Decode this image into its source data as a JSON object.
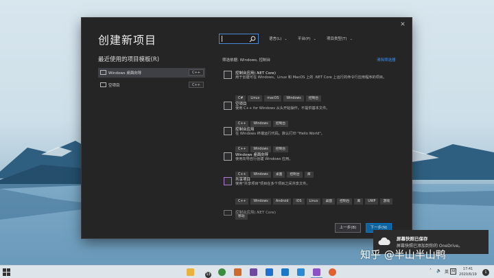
{
  "dialog": {
    "title": "创建新项目",
    "recent_heading": "最近使用的项目模板(R)",
    "close_glyph": "✕",
    "search": {
      "placeholder": ""
    },
    "filters": {
      "language": "语言(L)",
      "platform": "平台(P)",
      "project_type": "项目类型(T)"
    },
    "recent": [
      {
        "label": "Windows 桌面向导",
        "tag": "C++"
      },
      {
        "label": "空项目",
        "tag": "C++"
      }
    ],
    "filter_status": "筛选依据: Windows, 控制台",
    "clear_filter": "清除筛选器",
    "templates": [
      {
        "name": "控制台应用(.NET Core)",
        "desc": "用于创建可在 Windows、Linux 和 MacOS 上的 .NET Core 上运行的命令行应用程序的项目。",
        "tags": [
          "C#",
          "Linux",
          "macOS",
          "Windows",
          "控制台"
        ]
      },
      {
        "name": "空项目",
        "desc": "使用 C++ for Windows 从头开始操作。不提供基本文件。",
        "tags": [
          "C++",
          "Windows",
          "控制台"
        ]
      },
      {
        "name": "控制台应用",
        "desc": "在 Windows 终端运行代码。默认打印 \"Hello World\"。",
        "tags": [
          "C++",
          "Windows",
          "控制台"
        ]
      },
      {
        "name": "Windows 桌面向导",
        "desc": "使用向导自行创建 Windows 应用。",
        "tags": [
          "C++",
          "Windows",
          "桌面",
          "控制台",
          "库"
        ]
      },
      {
        "name": "共享项目",
        "desc": "使用\"共享项目\"项目在多个项目之间共享文件。",
        "tags": [
          "C++",
          "Windows",
          "Android",
          "iOS",
          "Linux",
          "桌面",
          "控制台",
          "库",
          "UWP",
          "游戏",
          "移动"
        ]
      },
      {
        "name": "控制台应用(.NET Core)",
        "desc": "",
        "tags": []
      }
    ],
    "back_button": "上一步(B)",
    "next_button": "下一步(N)"
  },
  "toast": {
    "title": "屏幕快照已保存",
    "body": "屏幕快照已添加到你的 OneDrive。"
  },
  "watermark": "知乎 @半山半山鸭",
  "taskbar": {
    "tray_lang": "英",
    "tray_m": "M",
    "time": "17:41",
    "date": "2020/6/19",
    "explorer_badge": "13",
    "notification_count": "1"
  },
  "colors": {
    "accent": "#3794ff",
    "dialog_bg": "#252526",
    "primary_button": "#0e639c"
  }
}
